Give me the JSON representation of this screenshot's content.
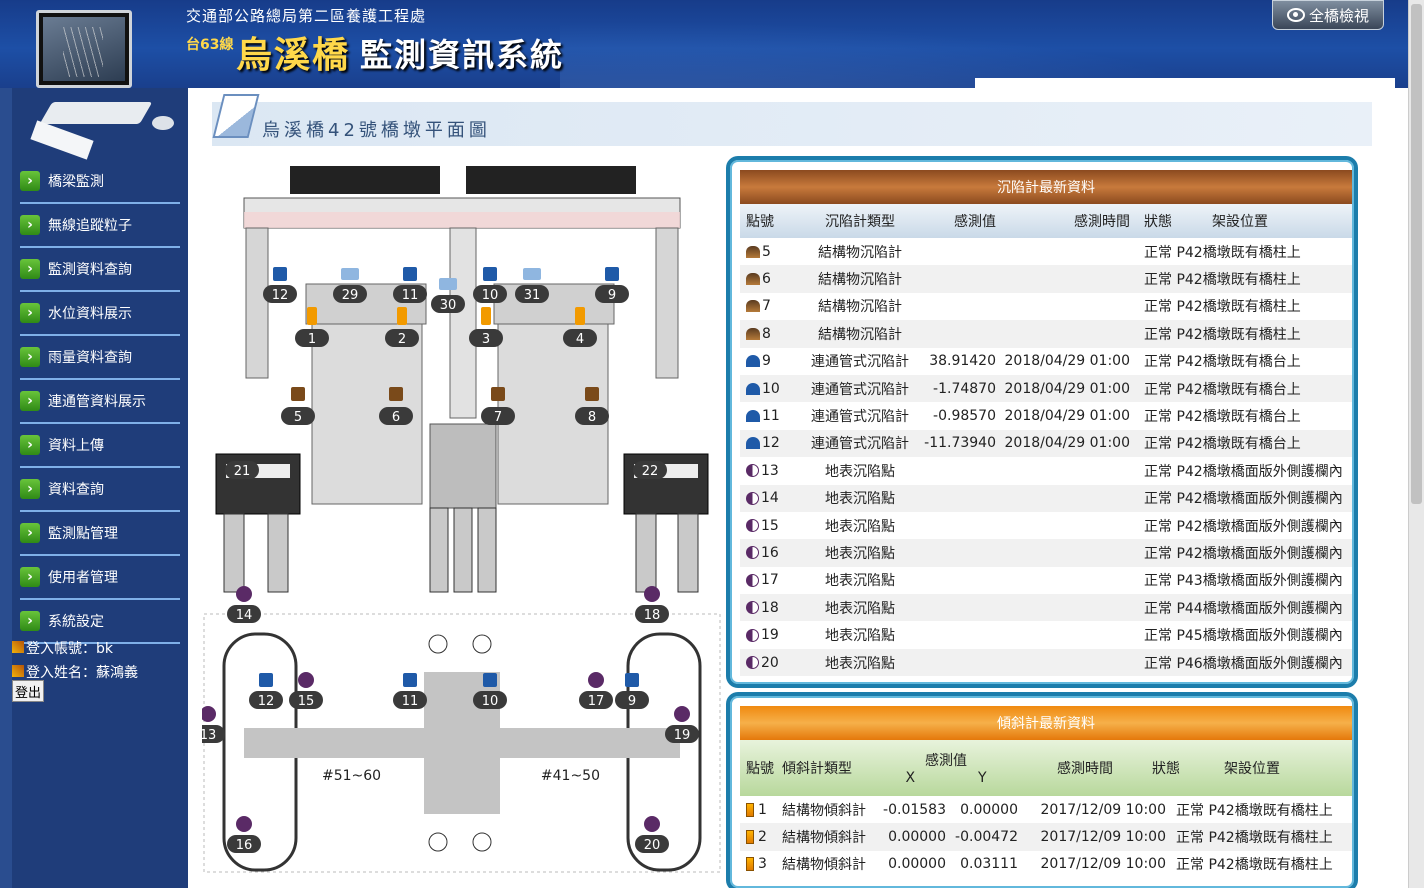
{
  "header": {
    "agency": "交通部公路總局第二區養護工程處",
    "route": "台63線",
    "bridge": "烏溪橋",
    "system": "監測資訊系統",
    "full_view_label": "全橋檢視"
  },
  "sidebar": {
    "items": [
      {
        "label": "橋梁監測"
      },
      {
        "label": "無線追蹤粒子"
      },
      {
        "label": "監測資料查詢"
      },
      {
        "label": "水位資料展示"
      },
      {
        "label": "雨量資料查詢"
      },
      {
        "label": "連通管資料展示"
      },
      {
        "label": "資料上傳"
      },
      {
        "label": "資料查詢"
      },
      {
        "label": "監測點管理"
      },
      {
        "label": "使用者管理"
      },
      {
        "label": "系統設定"
      }
    ],
    "account_label": "登入帳號：bk",
    "name_label": "登入姓名：蘇鴻義",
    "logout_label": "登出"
  },
  "page": {
    "title": "烏溪橋42號橋墩平面圖"
  },
  "diagram": {
    "tilt_markers": [
      "1",
      "2",
      "3",
      "4"
    ],
    "struct_markers": [
      "5",
      "6",
      "7",
      "8"
    ],
    "pipe_markers_elev": [
      "12",
      "11",
      "10",
      "9"
    ],
    "cam_markers": [
      "29",
      "30",
      "31"
    ],
    "abutment_markers": [
      "21",
      "22"
    ],
    "ground_markers": [
      "14",
      "15",
      "17",
      "18",
      "13",
      "19",
      "16",
      "20"
    ],
    "plan_pipe_markers": [
      "12",
      "11",
      "10",
      "9"
    ],
    "range_left": "#51~60",
    "range_right": "#41~50"
  },
  "settlement": {
    "caption": "沉陷計最新資料",
    "headers": [
      "點號",
      "沉陷計類型",
      "感測值",
      "感測時間",
      "狀態",
      "架設位置"
    ],
    "rows": [
      {
        "icon": "struct",
        "id": "5",
        "type": "結構物沉陷計",
        "value": "",
        "time": "",
        "status": "正常",
        "location": "P42橋墩既有橋柱上"
      },
      {
        "icon": "struct",
        "id": "6",
        "type": "結構物沉陷計",
        "value": "",
        "time": "",
        "status": "正常",
        "location": "P42橋墩既有橋柱上"
      },
      {
        "icon": "struct",
        "id": "7",
        "type": "結構物沉陷計",
        "value": "",
        "time": "",
        "status": "正常",
        "location": "P42橋墩既有橋柱上"
      },
      {
        "icon": "struct",
        "id": "8",
        "type": "結構物沉陷計",
        "value": "",
        "time": "",
        "status": "正常",
        "location": "P42橋墩既有橋柱上"
      },
      {
        "icon": "pipe",
        "id": "9",
        "type": "連通管式沉陷計",
        "value": "38.91420",
        "time": "2018/04/29 01:00",
        "status": "正常",
        "location": "P42橋墩既有橋台上"
      },
      {
        "icon": "pipe",
        "id": "10",
        "type": "連通管式沉陷計",
        "value": "-1.74870",
        "time": "2018/04/29 01:00",
        "status": "正常",
        "location": "P42橋墩既有橋台上"
      },
      {
        "icon": "pipe",
        "id": "11",
        "type": "連通管式沉陷計",
        "value": "-0.98570",
        "time": "2018/04/29 01:00",
        "status": "正常",
        "location": "P42橋墩既有橋台上"
      },
      {
        "icon": "pipe",
        "id": "12",
        "type": "連通管式沉陷計",
        "value": "-11.73940",
        "time": "2018/04/29 01:00",
        "status": "正常",
        "location": "P42橋墩既有橋台上"
      },
      {
        "icon": "ground",
        "id": "13",
        "type": "地表沉陷點",
        "value": "",
        "time": "",
        "status": "正常",
        "location": "P42橋墩橋面版外側護欄內"
      },
      {
        "icon": "ground",
        "id": "14",
        "type": "地表沉陷點",
        "value": "",
        "time": "",
        "status": "正常",
        "location": "P42橋墩橋面版外側護欄內"
      },
      {
        "icon": "ground",
        "id": "15",
        "type": "地表沉陷點",
        "value": "",
        "time": "",
        "status": "正常",
        "location": "P42橋墩橋面版外側護欄內"
      },
      {
        "icon": "ground",
        "id": "16",
        "type": "地表沉陷點",
        "value": "",
        "time": "",
        "status": "正常",
        "location": "P42橋墩橋面版外側護欄內"
      },
      {
        "icon": "ground",
        "id": "17",
        "type": "地表沉陷點",
        "value": "",
        "time": "",
        "status": "正常",
        "location": "P43橋墩橋面版外側護欄內"
      },
      {
        "icon": "ground",
        "id": "18",
        "type": "地表沉陷點",
        "value": "",
        "time": "",
        "status": "正常",
        "location": "P44橋墩橋面版外側護欄內"
      },
      {
        "icon": "ground",
        "id": "19",
        "type": "地表沉陷點",
        "value": "",
        "time": "",
        "status": "正常",
        "location": "P45橋墩橋面版外側護欄內"
      },
      {
        "icon": "ground",
        "id": "20",
        "type": "地表沉陷點",
        "value": "",
        "time": "",
        "status": "正常",
        "location": "P46橋墩橋面版外側護欄內"
      }
    ]
  },
  "tilt": {
    "caption": "傾斜計最新資料",
    "headers": {
      "id": "點號",
      "type": "傾斜計類型",
      "value": "感測值",
      "x": "X",
      "y": "Y",
      "time": "感測時間",
      "status": "狀態",
      "location": "架設位置"
    },
    "rows": [
      {
        "id": "1",
        "type": "結構物傾斜計",
        "x": "-0.01583",
        "y": "0.00000",
        "time": "2017/12/09 10:00",
        "status": "正常",
        "location": "P42橋墩既有橋柱上"
      },
      {
        "id": "2",
        "type": "結構物傾斜計",
        "x": "0.00000",
        "y": "-0.00472",
        "time": "2017/12/09 10:00",
        "status": "正常",
        "location": "P42橋墩既有橋柱上"
      },
      {
        "id": "3",
        "type": "結構物傾斜計",
        "x": "0.00000",
        "y": "0.03111",
        "time": "2017/12/09 10:00",
        "status": "正常",
        "location": "P42橋墩既有橋柱上"
      }
    ]
  }
}
